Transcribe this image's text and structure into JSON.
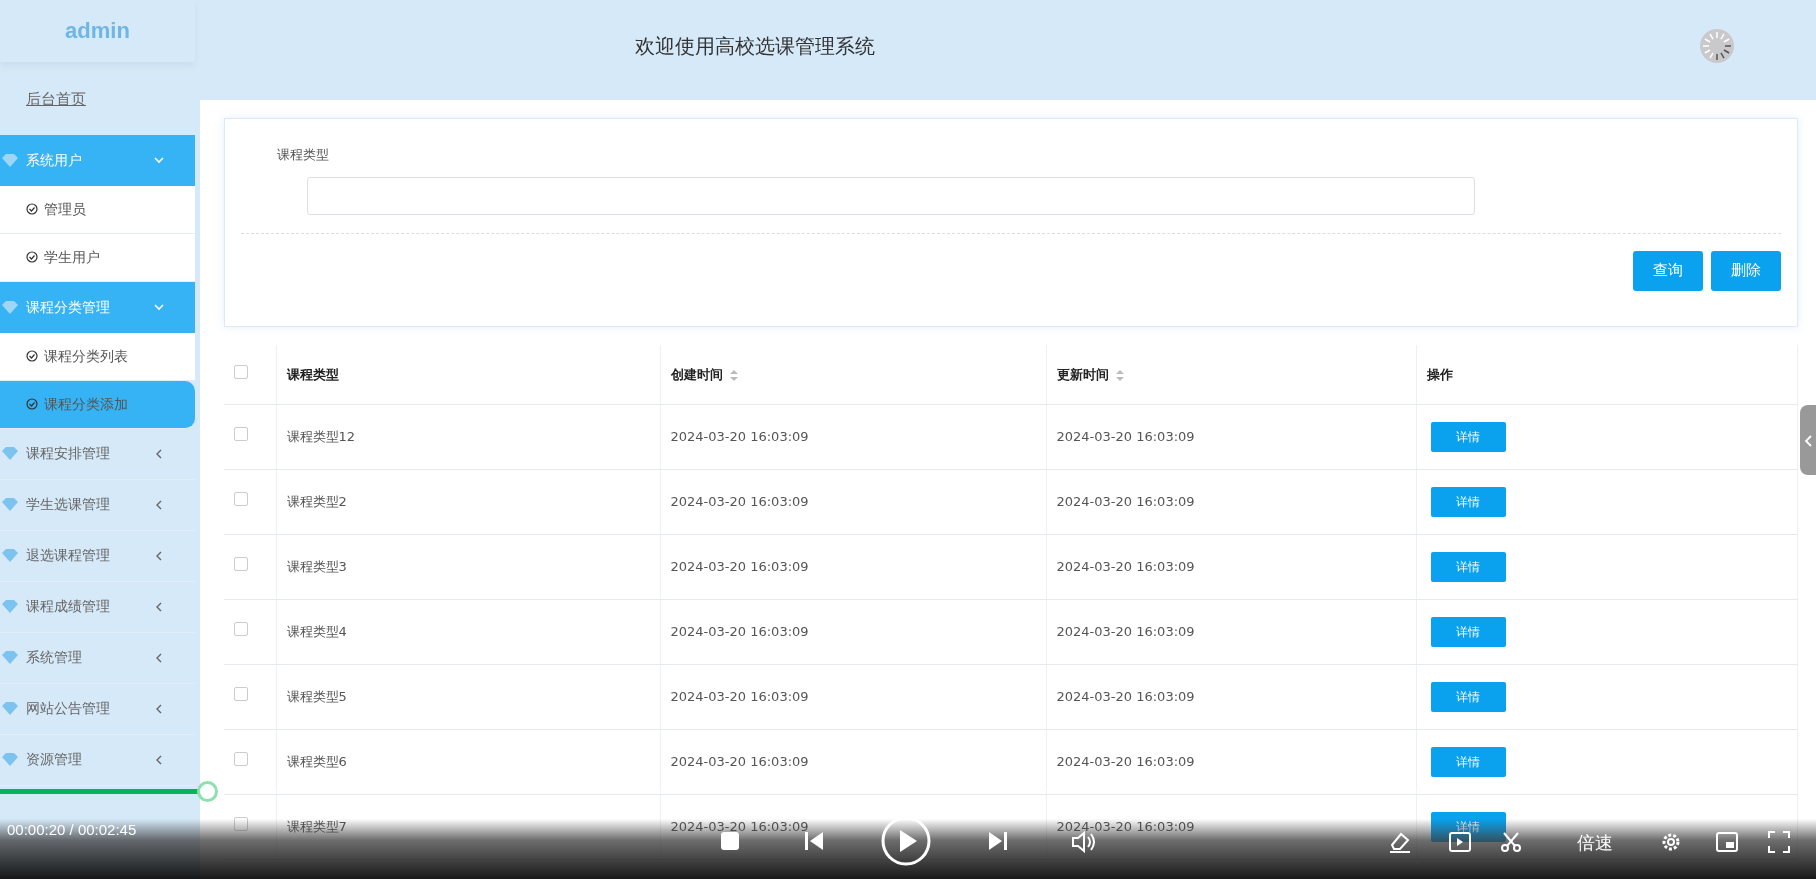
{
  "header": {
    "logo": "admin",
    "title": "欢迎使用高校选课管理系统"
  },
  "sidebar": {
    "items": [
      {
        "kind": "link",
        "label": "后台首页"
      },
      {
        "kind": "group",
        "label": "系统用户",
        "expanded": true,
        "children": [
          {
            "label": "管理员",
            "selected": false
          },
          {
            "label": "学生用户",
            "selected": false
          }
        ]
      },
      {
        "kind": "group",
        "label": "课程分类管理",
        "expanded": true,
        "children": [
          {
            "label": "课程分类列表",
            "selected": false
          },
          {
            "label": "课程分类添加",
            "selected": true
          }
        ]
      },
      {
        "kind": "group",
        "label": "课程安排管理",
        "expanded": false
      },
      {
        "kind": "group",
        "label": "学生选课管理",
        "expanded": false
      },
      {
        "kind": "group",
        "label": "退选课程管理",
        "expanded": false
      },
      {
        "kind": "group",
        "label": "课程成绩管理",
        "expanded": false
      },
      {
        "kind": "group",
        "label": "系统管理",
        "expanded": false
      },
      {
        "kind": "group",
        "label": "网站公告管理",
        "expanded": false
      },
      {
        "kind": "group",
        "label": "资源管理",
        "expanded": false
      }
    ]
  },
  "search": {
    "label": "课程类型",
    "buttons": [
      "查询",
      "删除"
    ]
  },
  "table": {
    "all_checked": false,
    "columns": [
      {
        "label": "课程类型",
        "sortable": false
      },
      {
        "label": "创建时间",
        "sortable": true
      },
      {
        "label": "更新时间",
        "sortable": true
      },
      {
        "label": "操作",
        "sortable": false
      }
    ],
    "rows": [
      {
        "checked": false,
        "cells": [
          "课程类型12",
          "2024-03-20 16:03:09",
          "2024-03-20 16:03:09"
        ],
        "action": "详情"
      },
      {
        "checked": false,
        "cells": [
          "课程类型2",
          "2024-03-20 16:03:09",
          "2024-03-20 16:03:09"
        ],
        "action": "详情"
      },
      {
        "checked": false,
        "cells": [
          "课程类型3",
          "2024-03-20 16:03:09",
          "2024-03-20 16:03:09"
        ],
        "action": "详情"
      },
      {
        "checked": false,
        "cells": [
          "课程类型4",
          "2024-03-20 16:03:09",
          "2024-03-20 16:03:09"
        ],
        "action": "详情"
      },
      {
        "checked": false,
        "cells": [
          "课程类型5",
          "2024-03-20 16:03:09",
          "2024-03-20 16:03:09"
        ],
        "action": "详情"
      },
      {
        "checked": false,
        "cells": [
          "课程类型6",
          "2024-03-20 16:03:09",
          "2024-03-20 16:03:09"
        ],
        "action": "详情"
      },
      {
        "checked": false,
        "cells": [
          "课程类型7",
          "2024-03-20 16:03:09",
          "2024-03-20 16:03:09"
        ],
        "action": "详情"
      }
    ]
  },
  "player": {
    "level": 0.114,
    "time": "00:00:20 / 00:02:45",
    "playing": false,
    "speed": "倍速"
  }
}
